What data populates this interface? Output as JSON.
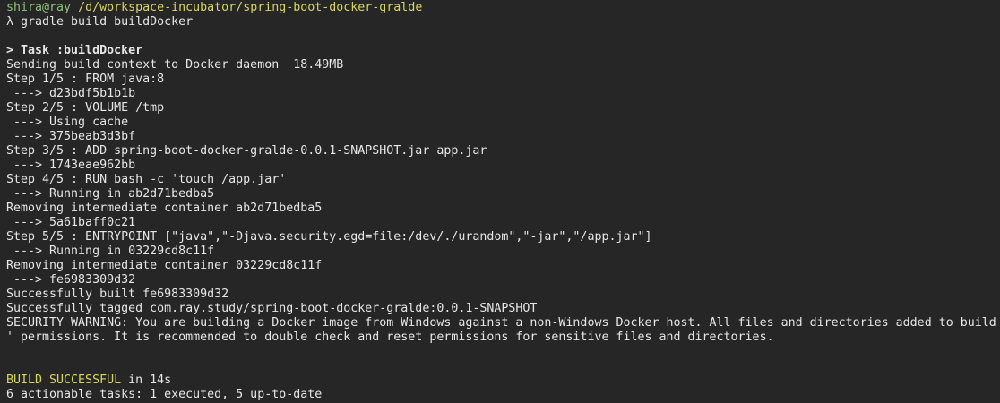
{
  "terminal": {
    "colors": {
      "background": "#262626",
      "text": "#e6e6e6",
      "user_host": "#8ec07c",
      "path": "#d7d75f",
      "success": "#d7d75f"
    },
    "lines": [
      [
        {
          "text": "shira@ray",
          "color": "green"
        },
        {
          "text": " /d/workspace-incubator/spring-boot-docker-gralde",
          "color": "yellow"
        }
      ],
      [
        {
          "text": "λ gradle build buildDocker"
        }
      ],
      [
        {
          "text": ""
        }
      ],
      [
        {
          "text": "> Task :buildDocker",
          "bold": true
        }
      ],
      [
        {
          "text": "Sending build context to Docker daemon  18.49MB"
        }
      ],
      [
        {
          "text": "Step 1/5 : FROM java:8"
        }
      ],
      [
        {
          "text": " ---> d23bdf5b1b1b"
        }
      ],
      [
        {
          "text": "Step 2/5 : VOLUME /tmp"
        }
      ],
      [
        {
          "text": " ---> Using cache"
        }
      ],
      [
        {
          "text": " ---> 375beab3d3bf"
        }
      ],
      [
        {
          "text": "Step 3/5 : ADD spring-boot-docker-gralde-0.0.1-SNAPSHOT.jar app.jar"
        }
      ],
      [
        {
          "text": " ---> 1743eae962bb"
        }
      ],
      [
        {
          "text": "Step 4/5 : RUN bash -c 'touch /app.jar'"
        }
      ],
      [
        {
          "text": " ---> Running in ab2d71bedba5"
        }
      ],
      [
        {
          "text": "Removing intermediate container ab2d71bedba5"
        }
      ],
      [
        {
          "text": " ---> 5a61baff0c21"
        }
      ],
      [
        {
          "text": "Step 5/5 : ENTRYPOINT [\"java\",\"-Djava.security.egd=file:/dev/./urandom\",\"-jar\",\"/app.jar\"]"
        }
      ],
      [
        {
          "text": " ---> Running in 03229cd8c11f"
        }
      ],
      [
        {
          "text": "Removing intermediate container 03229cd8c11f"
        }
      ],
      [
        {
          "text": " ---> fe6983309d32"
        }
      ],
      [
        {
          "text": "Successfully built fe6983309d32"
        }
      ],
      [
        {
          "text": "Successfully tagged com.ray.study/spring-boot-docker-gralde:0.0.1-SNAPSHOT"
        }
      ],
      [
        {
          "text": "SECURITY WARNING: You are building a Docker image from Windows against a non-Windows Docker host. All files and directories added to build"
        }
      ],
      [
        {
          "text": "' permissions. It is recommended to double check and reset permissions for sensitive files and directories."
        }
      ],
      [
        {
          "text": ""
        }
      ],
      [
        {
          "text": ""
        }
      ],
      [
        {
          "text": "BUILD SUCCESSFUL",
          "color": "yellow"
        },
        {
          "text": " in 14s"
        }
      ],
      [
        {
          "text": "6 actionable tasks: 1 executed, 5 up-to-date"
        }
      ]
    ]
  }
}
